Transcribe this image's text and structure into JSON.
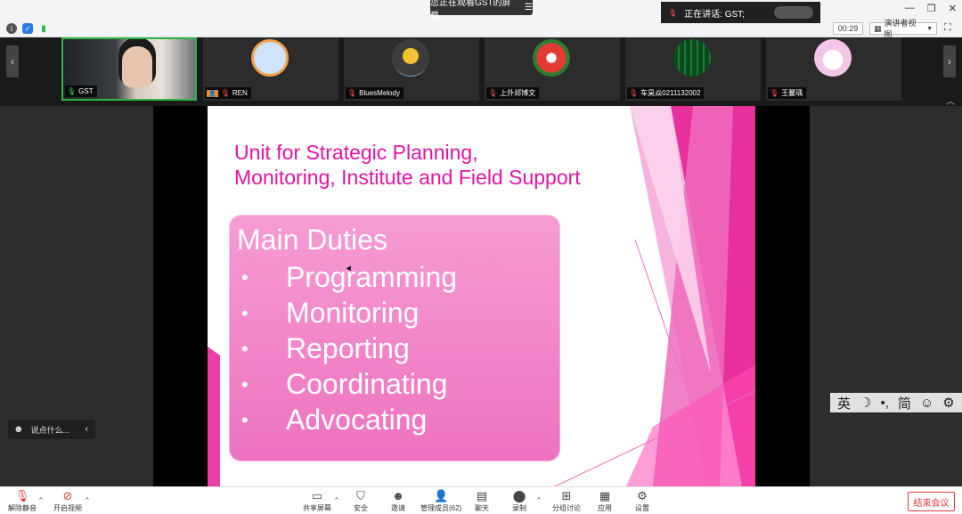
{
  "window": {
    "viewing_banner": "您正在观看GST的屏幕",
    "talking_label": "正在讲话: GST;"
  },
  "statusbar": {
    "timer": "00:29",
    "view_mode": "演讲者视图"
  },
  "participants": [
    {
      "name": "GST",
      "mic": "on",
      "video": true
    },
    {
      "name": "REN",
      "mic": "off",
      "video": false
    },
    {
      "name": "BluesMelody",
      "mic": "off",
      "video": false
    },
    {
      "name": "上外郑博文",
      "mic": "off",
      "video": false
    },
    {
      "name": "车昊焱0211132002",
      "mic": "off",
      "video": false
    },
    {
      "name": "王馨瑀",
      "mic": "off",
      "video": false
    }
  ],
  "slide": {
    "title_line1": "Unit for Strategic Planning,",
    "title_line2": "Monitoring, Institute and Field Support",
    "box_heading": "Main Duties",
    "duties": [
      "Programming",
      "Monitoring",
      "Reporting",
      "Coordinating",
      "Advocating"
    ],
    "bullet": "•"
  },
  "chat": {
    "placeholder": "说点什么..."
  },
  "ime": {
    "lang": "英",
    "simplified": "简"
  },
  "toolbar": {
    "unmute": "解除静音",
    "start_video": "开启视频",
    "share_screen": "共享屏幕",
    "security": "安全",
    "invite": "邀请",
    "manage_participants": "管理成员(62)",
    "chat": "聊天",
    "record": "录制",
    "breakout": "分组讨论",
    "apps": "应用",
    "settings": "设置",
    "end_meeting": "结束会议"
  },
  "colors": {
    "slide_title": "#e313a5",
    "box_pink": "#f08ac8",
    "active_tile": "#2fb344",
    "end_button": "#e4393c"
  }
}
